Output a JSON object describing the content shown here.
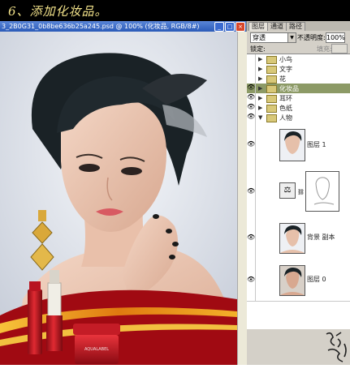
{
  "banner": {
    "title": "6、添加化妆品。"
  },
  "document": {
    "title": "3_2B0G31_0b8be636b25a245.psd @ 100% (化妆品, RGB/8#)",
    "minimize": "_",
    "maximize": "□",
    "close": "×"
  },
  "panel": {
    "tabs": [
      "图层",
      "通道",
      "路径"
    ],
    "blend_mode": "穿透",
    "opacity_label": "不透明度:",
    "opacity_value": "100%",
    "lock_label": "锁定:",
    "fill_label": "填充:",
    "layers": [
      {
        "name": "小鸟",
        "type": "group",
        "visible": false
      },
      {
        "name": "文字",
        "type": "group",
        "visible": false
      },
      {
        "name": "花",
        "type": "group",
        "visible": false
      },
      {
        "name": "化妆品",
        "type": "group",
        "visible": true,
        "selected": true
      },
      {
        "name": "耳环",
        "type": "group",
        "visible": true
      },
      {
        "name": "色纸",
        "type": "group",
        "visible": true
      },
      {
        "name": "人物",
        "type": "group-open",
        "visible": true
      },
      {
        "name": "图层 1",
        "type": "layer",
        "visible": true
      },
      {
        "name": "",
        "type": "adjustment",
        "visible": true
      },
      {
        "name": "背景 副本",
        "type": "layer",
        "visible": true
      },
      {
        "name": "图层 0",
        "type": "layer",
        "visible": true
      }
    ]
  },
  "product": {
    "brand": "AQUALABEL"
  },
  "signature": "昭博设计"
}
